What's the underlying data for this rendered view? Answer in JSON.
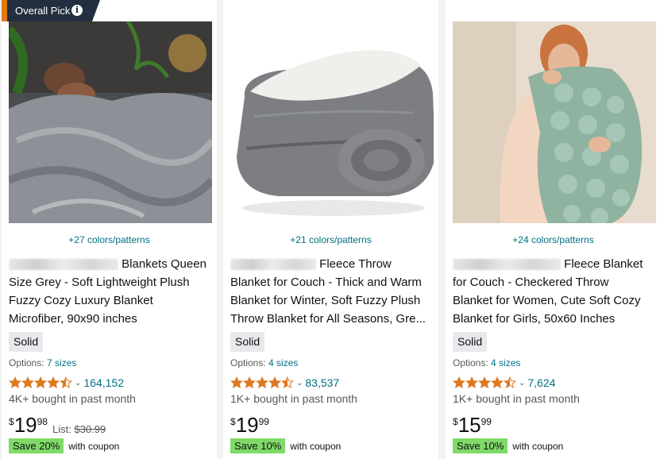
{
  "badge": {
    "label": "Overall Pick",
    "info_glyph": "i"
  },
  "products": [
    {
      "colors_link": "+27 colors/patterns",
      "title_lines": [
        "Blankets Queen",
        "Size Grey - Soft Lightweight Plush",
        "Fuzzy Cozy Luxury Blanket",
        "Microfiber, 90x90 inches"
      ],
      "style_label": "Solid",
      "options_label": "Options:",
      "options_value": "7 sizes",
      "rating": 4.5,
      "rating_count": "164,152",
      "bought": "4K+ bought in past month",
      "price_symbol": "$",
      "price_whole": "19",
      "price_fraction": "98",
      "list_label": "List:",
      "list_price": "$30.99",
      "save_label": "Save 20%",
      "coupon_text": "with coupon",
      "image_icon": "grey-blanket-bed-photo"
    },
    {
      "colors_link": "+21 colors/patterns",
      "title_lines": [
        "Fleece Throw",
        "Blanket for Couch - Thick and Warm",
        "Blanket for Winter, Soft Fuzzy Plush",
        "Throw Blanket for All Seasons, Gre..."
      ],
      "style_label": "Solid",
      "options_label": "Options:",
      "options_value": "4 sizes",
      "rating": 4.5,
      "rating_count": "83,537",
      "bought": "1K+ bought in past month",
      "price_symbol": "$",
      "price_whole": "19",
      "price_fraction": "99",
      "save_label": "Save 10%",
      "coupon_text": "with coupon",
      "image_icon": "folded-fleece-blanket-photo"
    },
    {
      "colors_link": "+24 colors/patterns",
      "title_lines": [
        "Fleece Blanket",
        "for Couch - Checkered Throw",
        "Blanket for Women, Cute Soft Cozy",
        "Blanket for Girls, 50x60 Inches"
      ],
      "style_label": "Solid",
      "options_label": "Options:",
      "options_value": "4 sizes",
      "rating": 4.5,
      "rating_count": "7,624",
      "bought": "1K+ bought in past month",
      "price_symbol": "$",
      "price_whole": "15",
      "price_fraction": "99",
      "save_label": "Save 10%",
      "coupon_text": "with coupon",
      "image_icon": "woman-green-blanket-photo"
    }
  ],
  "colors": {
    "link": "#007185",
    "star": "#de7921",
    "save_bg": "#7fda69",
    "badge_bg": "#232f3e",
    "badge_accent": "#e47911"
  }
}
